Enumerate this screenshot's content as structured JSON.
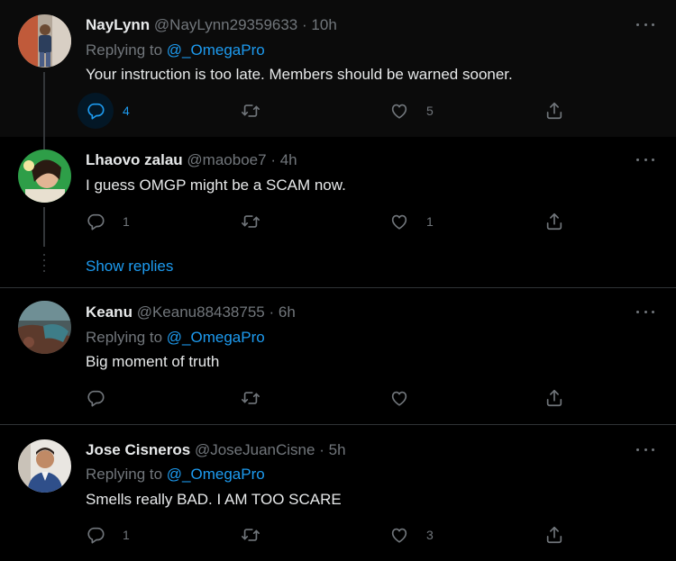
{
  "tweets": [
    {
      "name": "NayLynn",
      "handle": "@NayLynn29359633",
      "time": "10h",
      "replying_prefix": "Replying to",
      "replying_to": "@_OmegaPro",
      "text": "Your instruction is too late. Members should be warned sooner.",
      "replies": "4",
      "retweets": "",
      "likes": "5"
    },
    {
      "name": "Lhaovo zalau",
      "handle": "@maoboe7",
      "time": "4h",
      "text": "I guess OMGP might be a SCAM now.",
      "replies": "1",
      "retweets": "",
      "likes": "1",
      "show_replies": "Show replies"
    },
    {
      "name": "Keanu",
      "handle": "@Keanu88438755",
      "time": "6h",
      "replying_prefix": "Replying to",
      "replying_to": "@_OmegaPro",
      "text": "Big moment of truth",
      "replies": "",
      "retweets": "",
      "likes": ""
    },
    {
      "name": "Jose Cisneros",
      "handle": "@JoseJuanCisne",
      "time": "5h",
      "replying_prefix": "Replying to",
      "replying_to": "@_OmegaPro",
      "text": "Smells really BAD. I AM TOO SCARE",
      "replies": "1",
      "retweets": "",
      "likes": "3"
    }
  ],
  "separator": "·",
  "colors": {
    "background": "#000000",
    "accent": "#1d9bf0",
    "muted": "#71767b",
    "text": "#e7e9ea"
  },
  "icons": [
    "reply-icon",
    "retweet-icon",
    "like-icon",
    "share-icon",
    "more-icon"
  ]
}
